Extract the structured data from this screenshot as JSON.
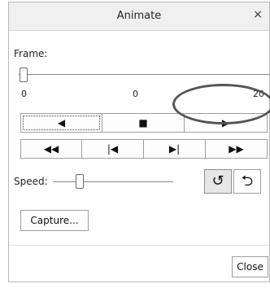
{
  "window": {
    "title": "Animate",
    "close_glyph": "×"
  },
  "frame": {
    "label": "Frame:",
    "value": 0,
    "min": 0,
    "max": 20,
    "tick_labels": [
      "0",
      "0",
      "20"
    ]
  },
  "playback": {
    "row1": [
      {
        "name": "play-backward-button",
        "icon": "triangle-left-icon",
        "glyph": "◀",
        "focused": true
      },
      {
        "name": "stop-button",
        "icon": "square-icon",
        "glyph": "■"
      },
      {
        "name": "play-forward-button",
        "icon": "triangle-right-icon",
        "glyph": "▶"
      }
    ],
    "row2": [
      {
        "name": "rewind-button",
        "icon": "double-left-icon",
        "glyph": "◀◀"
      },
      {
        "name": "step-back-button",
        "icon": "step-back-icon",
        "glyph": "|◀"
      },
      {
        "name": "step-forward-button",
        "icon": "step-forward-icon",
        "glyph": "▶|"
      },
      {
        "name": "fast-forward-button",
        "icon": "double-right-icon",
        "glyph": "▶▶"
      }
    ]
  },
  "speed": {
    "label": "Speed:",
    "level": 0.2
  },
  "loop_modes": [
    {
      "name": "loop-button",
      "icon": "loop-arrow-icon",
      "glyph": "↺",
      "selected": true
    },
    {
      "name": "bounce-button",
      "icon": "bounce-arrow-icon",
      "glyph": "⮌",
      "selected": false
    }
  ],
  "capture_label": "Capture...",
  "close_label": "Close",
  "highlight": {
    "color": "#555555"
  }
}
